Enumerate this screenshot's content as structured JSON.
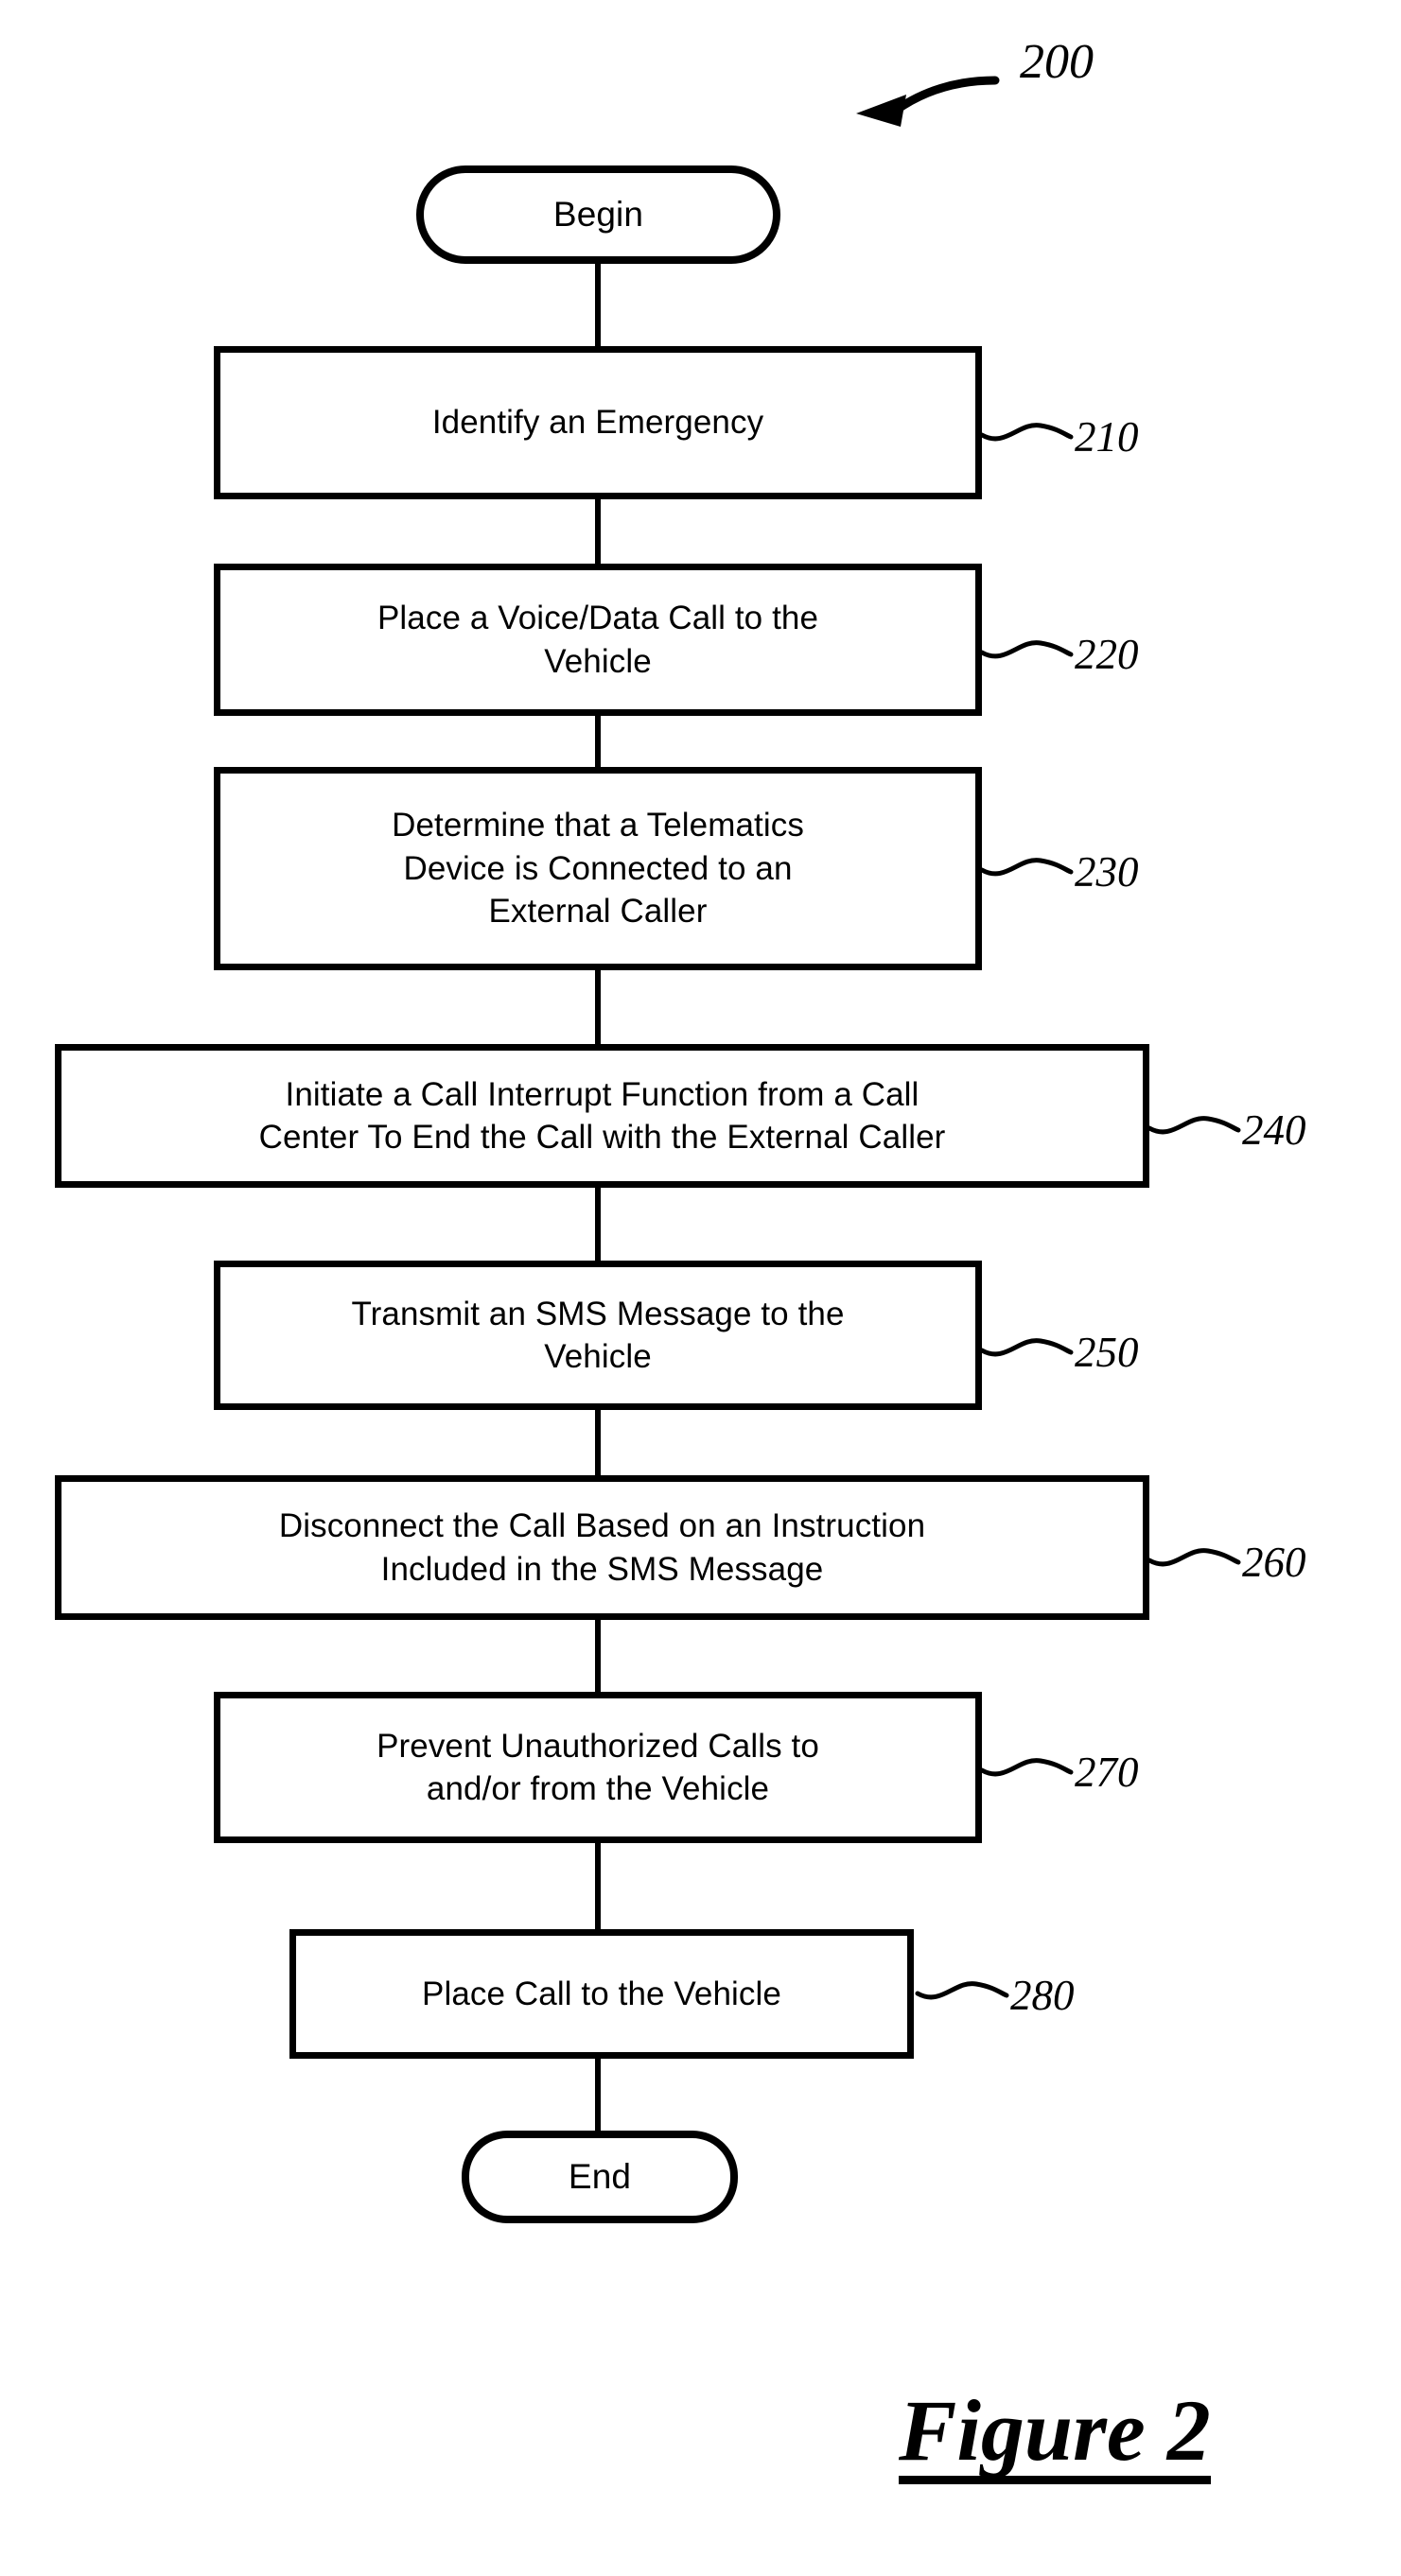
{
  "figure": {
    "caption": "Figure 2",
    "diagram_ref": "200",
    "diagram_type": "flowchart"
  },
  "nodes": [
    {
      "id": "begin",
      "shape": "terminator",
      "label": "Begin",
      "ref": null
    },
    {
      "id": "step-210",
      "shape": "process",
      "label": "Identify an Emergency",
      "ref": "210"
    },
    {
      "id": "step-220",
      "shape": "process",
      "label": "Place a Voice/Data Call to the\nVehicle",
      "ref": "220"
    },
    {
      "id": "step-230",
      "shape": "process",
      "label": "Determine that a Telematics\nDevice is Connected to an\nExternal Caller",
      "ref": "230"
    },
    {
      "id": "step-240",
      "shape": "process",
      "label": "Initiate a Call Interrupt Function from a Call\nCenter To End the Call with the External Caller",
      "ref": "240"
    },
    {
      "id": "step-250",
      "shape": "process",
      "label": "Transmit an SMS Message to the\nVehicle",
      "ref": "250"
    },
    {
      "id": "step-260",
      "shape": "process",
      "label": "Disconnect the Call Based on an Instruction\nIncluded in the SMS Message",
      "ref": "260"
    },
    {
      "id": "step-270",
      "shape": "process",
      "label": "Prevent Unauthorized Calls to\nand/or from the Vehicle",
      "ref": "270"
    },
    {
      "id": "step-280",
      "shape": "process",
      "label": "Place Call to the Vehicle",
      "ref": "280"
    },
    {
      "id": "end",
      "shape": "terminator",
      "label": "End",
      "ref": null
    }
  ],
  "style": {
    "stroke_color": "#000000",
    "fill_color": "#ffffff",
    "background": "#ffffff"
  }
}
